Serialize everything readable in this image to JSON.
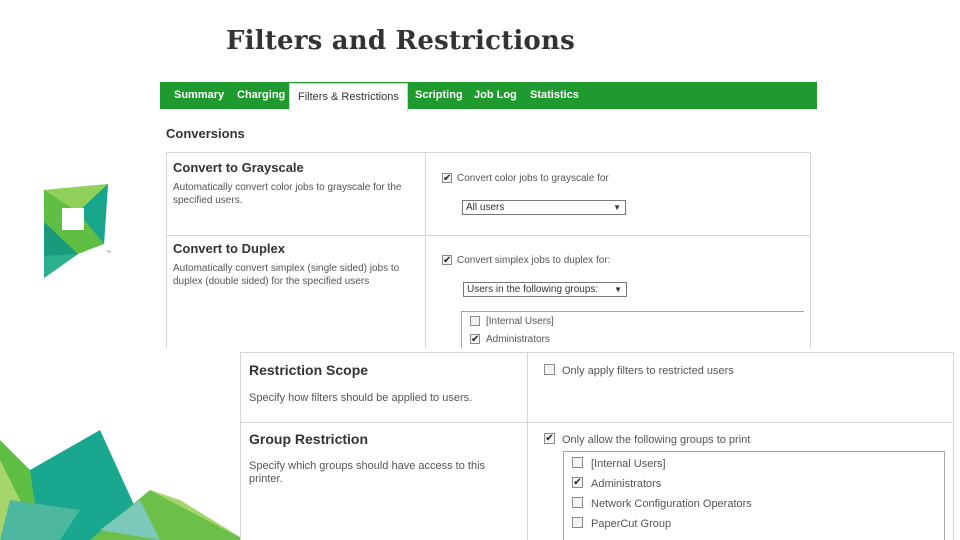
{
  "slide": {
    "title": "Filters and Restrictions"
  },
  "tabs": [
    {
      "label": "Summary"
    },
    {
      "label": "Charging"
    },
    {
      "label": "Filters & Restrictions",
      "active": true
    },
    {
      "label": "Scripting"
    },
    {
      "label": "Job Log"
    },
    {
      "label": "Statistics"
    }
  ],
  "conversions": {
    "heading": "Conversions",
    "grayscale": {
      "title": "Convert to Grayscale",
      "desc_line1": "Automatically convert color jobs to grayscale for the",
      "desc_line2": "specified users.",
      "checkbox_label": "Convert color jobs to grayscale for",
      "checked": true,
      "select_value": "All users"
    },
    "duplex": {
      "title": "Convert to Duplex",
      "desc_line1": "Automatically convert simplex (single sided) jobs to",
      "desc_line2": "duplex (double sided) for the specified users",
      "checkbox_label": "Convert simplex jobs to duplex for:",
      "checked": true,
      "select_value": "Users in the following groups:",
      "groups": [
        {
          "label": "[Internal Users]",
          "checked": false
        },
        {
          "label": "Administrators",
          "checked": true
        }
      ]
    }
  },
  "restrictions": {
    "scope": {
      "title": "Restriction Scope",
      "desc": "Specify how filters should be applied to users.",
      "checkbox_label": "Only apply filters to restricted users",
      "checked": false
    },
    "group": {
      "title": "Group Restriction",
      "desc_line1": "Specify which groups should have access to this",
      "desc_line2": "printer.",
      "checkbox_label": "Only allow the following groups to print",
      "checked": true,
      "groups": [
        {
          "label": "[Internal Users]",
          "checked": false
        },
        {
          "label": "Administrators",
          "checked": true
        },
        {
          "label": "Network Configuration Operators",
          "checked": false
        },
        {
          "label": "PaperCut Group",
          "checked": false
        }
      ]
    }
  },
  "colors": {
    "tab_green": "#1f9a2f",
    "logo_green": "#6cc04a",
    "logo_teal": "#1aa78f"
  },
  "icons": {
    "checkbox_checked": "✔",
    "dropdown": "▼"
  }
}
